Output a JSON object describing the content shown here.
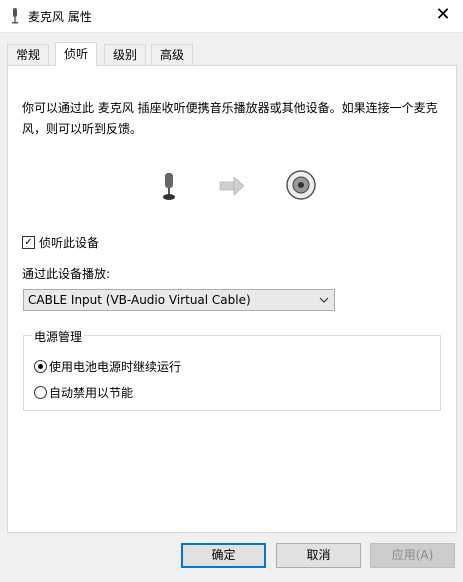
{
  "window": {
    "title": "麦克风 属性",
    "close_glyph": "✕",
    "icon": "microphone-icon"
  },
  "tabs": [
    {
      "label": "常规"
    },
    {
      "label": "侦听",
      "active": true
    },
    {
      "label": "级别"
    },
    {
      "label": "高级"
    }
  ],
  "listen": {
    "description": "你可以通过此 麦克风 插座收听便携音乐播放器或其他设备。如果连接一个麦克风，则可以听到反馈。",
    "listen_checkbox_label": "侦听此设备",
    "listen_checked": true,
    "playback_label": "通过此设备播放:",
    "playback_device": "CABLE Input (VB-Audio Virtual Cable)"
  },
  "power": {
    "group_title": "电源管理",
    "options": [
      {
        "label": "使用电池电源时继续运行",
        "selected": true
      },
      {
        "label": "自动禁用以节能",
        "selected": false
      }
    ]
  },
  "buttons": {
    "ok": "确定",
    "cancel": "取消",
    "apply": "应用(A)"
  },
  "colors": {
    "accent": "#0078d7"
  }
}
